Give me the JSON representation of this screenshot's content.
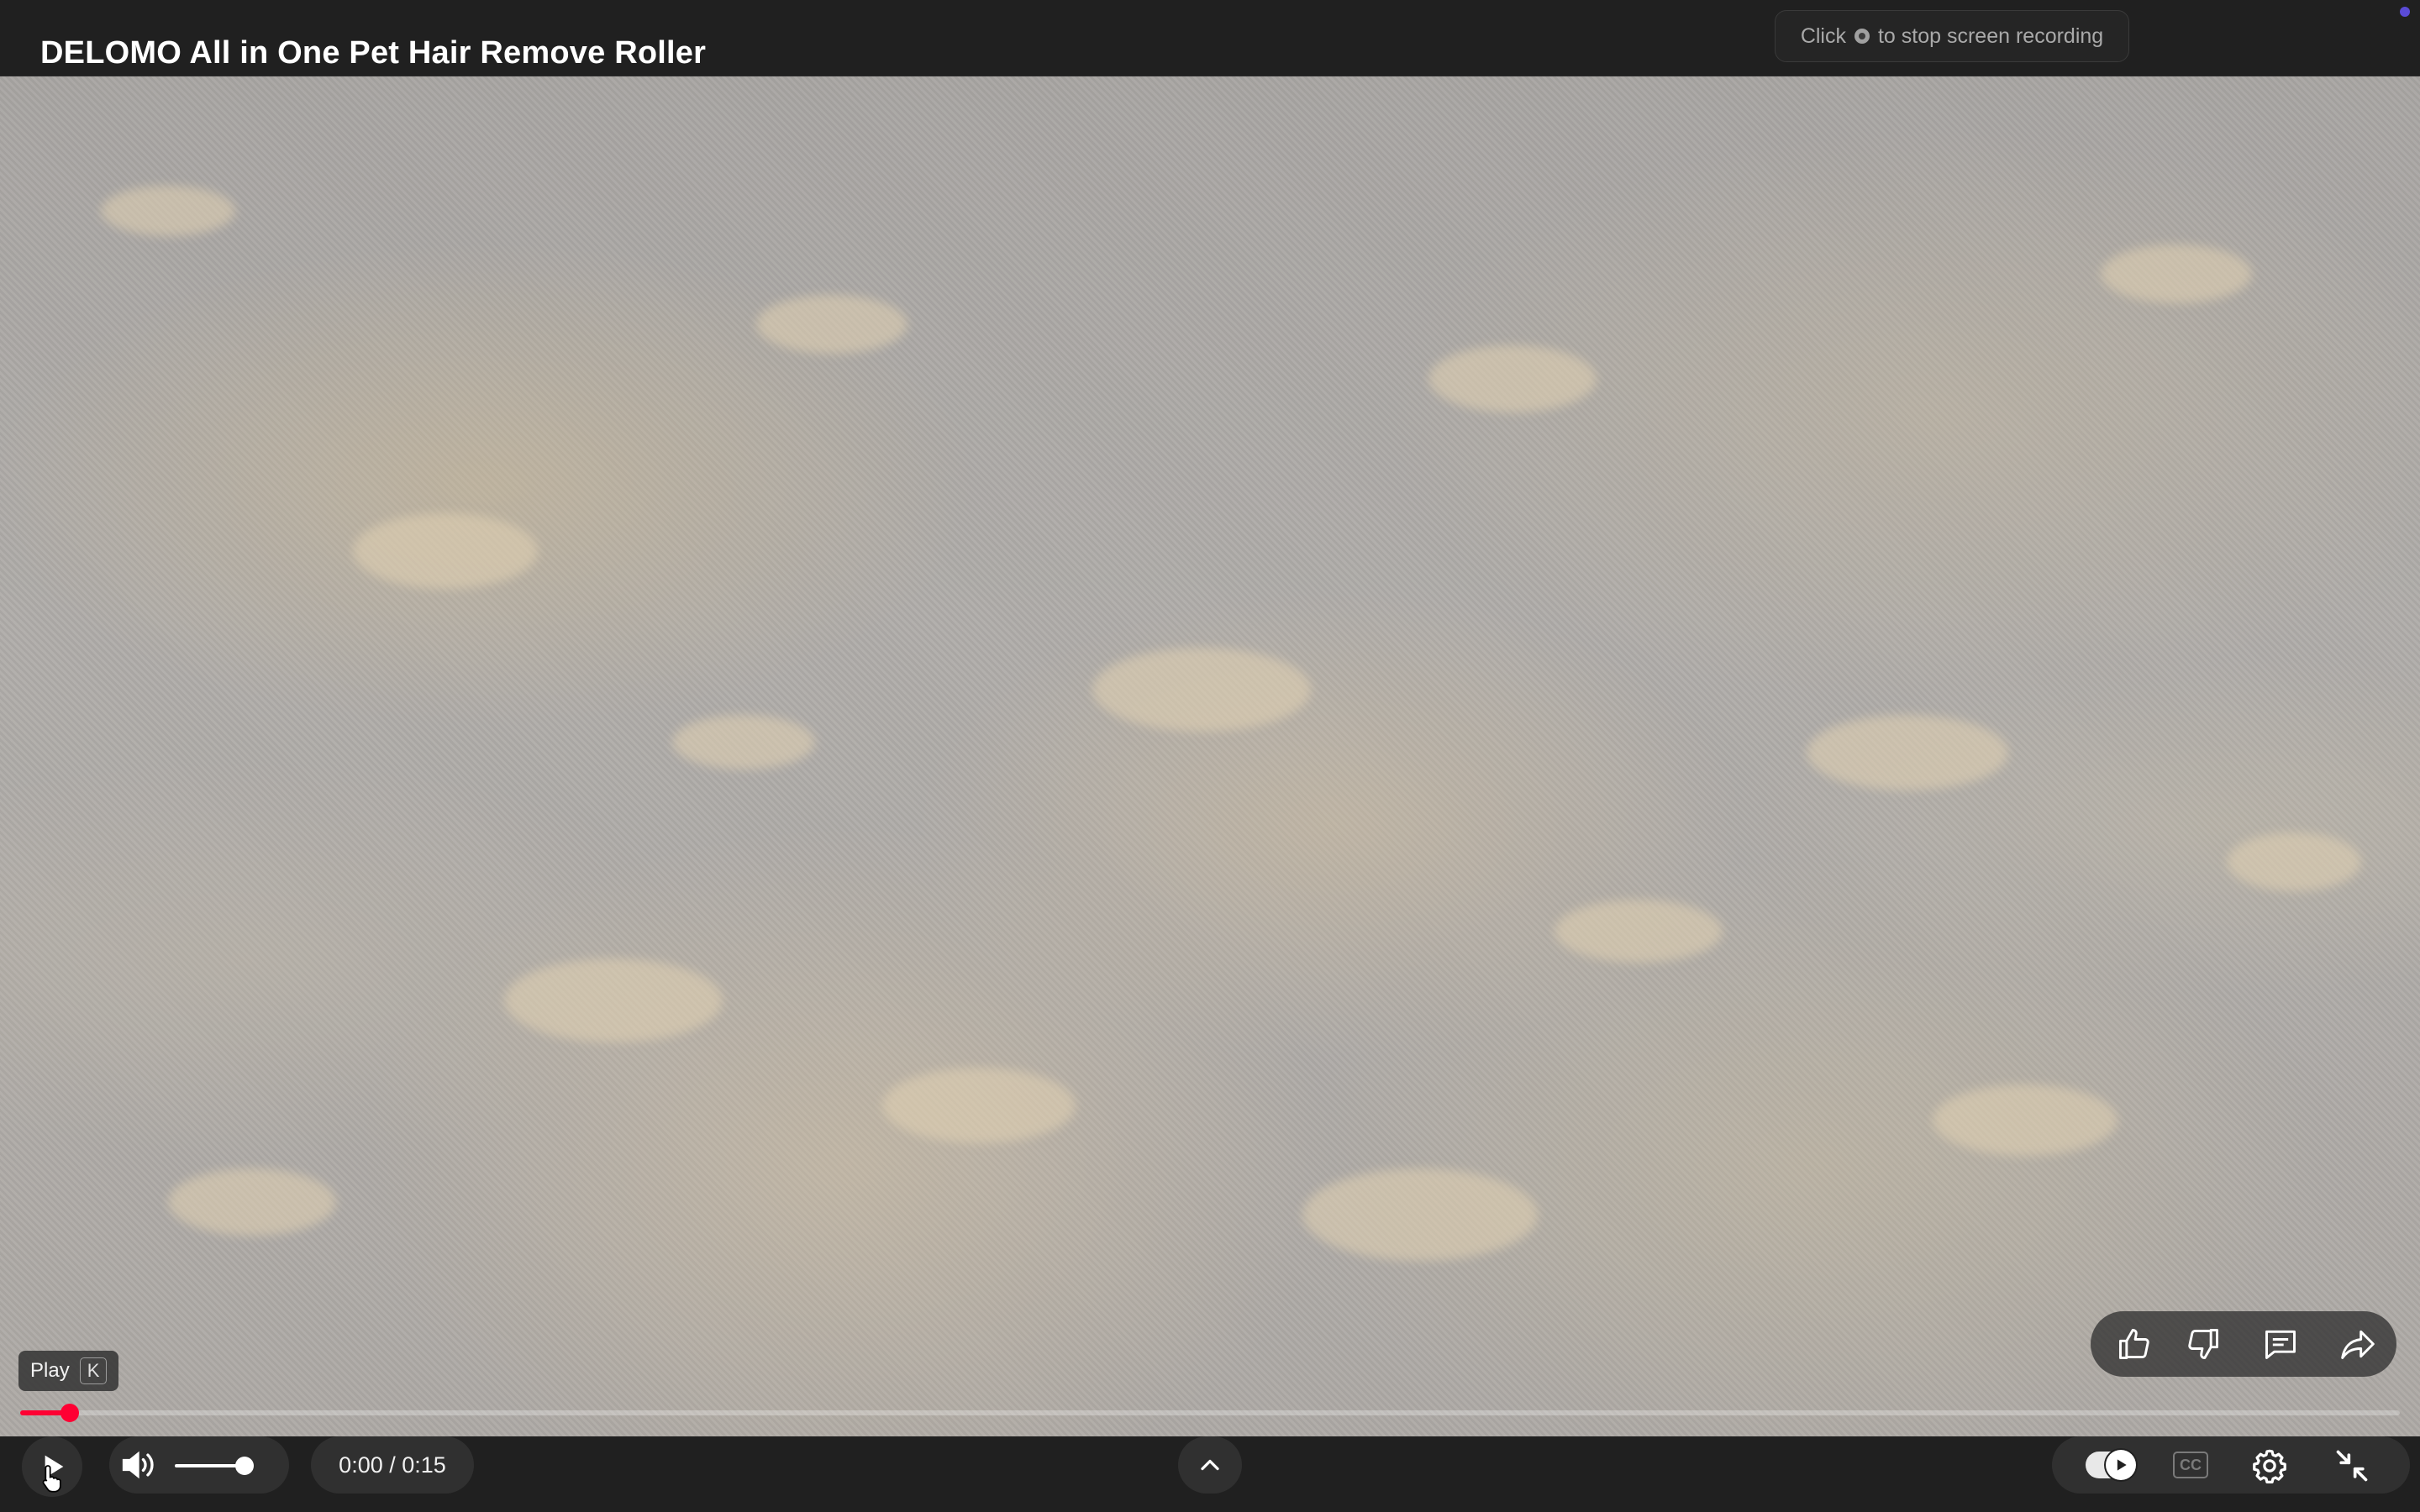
{
  "video": {
    "title": "DELOMO All in One Pet Hair Remove Roller"
  },
  "recording_banner": {
    "before": "Click",
    "after": "to stop screen recording"
  },
  "tooltip": {
    "label": "Play",
    "shortcut": "K"
  },
  "player": {
    "current_time": "0:00",
    "separator": " / ",
    "duration": "0:15",
    "progress_fraction": 0.021,
    "volume_fraction": 0.9,
    "autoplay_on": true,
    "captions_available": false,
    "cc_label": "CC"
  },
  "actions": {
    "items": [
      "thumbs-up-icon",
      "thumbs-down-icon",
      "comment-icon",
      "share-icon"
    ]
  },
  "colors": {
    "accent": "#ff0033",
    "bar": "#202020",
    "control_bg": "#303030"
  }
}
